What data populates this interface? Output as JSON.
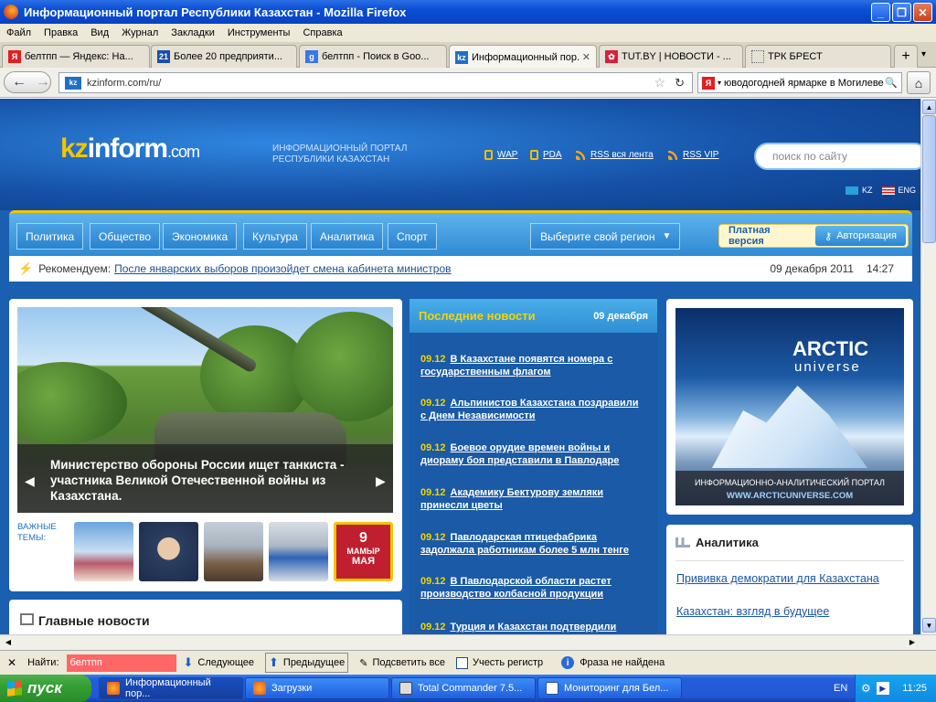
{
  "window": {
    "title": "Информационный портал Республики Казахстан - Mozilla Firefox"
  },
  "menu": [
    "Файл",
    "Правка",
    "Вид",
    "Журнал",
    "Закладки",
    "Инструменты",
    "Справка"
  ],
  "tabs": [
    {
      "label": "белтпп — Яндекс: На...",
      "icon": "yandex-icon",
      "color": "#e02020",
      "glyph": "Я"
    },
    {
      "label": "Более 20 предприяти...",
      "icon": "21-icon",
      "color": "#1a4fa8",
      "glyph": "21"
    },
    {
      "label": "белтпп - Поиск в Goo...",
      "icon": "google-icon",
      "color": "#3b78e7",
      "glyph": "g"
    },
    {
      "label": "Информационный пор...",
      "icon": "kz-icon",
      "color": "#1f6fc8",
      "glyph": "kz"
    },
    {
      "label": "TUT.BY | НОВОСТИ - ...",
      "icon": "tutby-icon",
      "color": "#d8203c",
      "glyph": "✿"
    },
    {
      "label": "ТРК БРЕСТ",
      "icon": "blank-page-icon",
      "color": "#ffffff",
      "glyph": ""
    }
  ],
  "nav": {
    "url": "kzinform.com/ru/",
    "search_value": "юводогодней ярмарке в Могилеве"
  },
  "site": {
    "logo_kz": "kz",
    "logo_inform": "inform",
    "logo_com": ".com",
    "portal_line1": "ИНФОРМАЦИОННЫЙ ПОРТАЛ",
    "portal_line2": "РЕСПУБЛИКИ КАЗАХСТАН",
    "links": [
      "WAP",
      "PDA",
      "RSS вся лента",
      "RSS VIP"
    ],
    "search_placeholder": "поиск по сайту",
    "lang_kz": "KZ",
    "lang_eng": "ENG"
  },
  "sections": [
    "Политика",
    "Общество",
    "Экономика",
    "Культура",
    "Аналитика",
    "Спорт"
  ],
  "region": "Выберите свой регион",
  "paid": "Платная версия",
  "auth": "Авторизация",
  "recommend": {
    "label": "Рекомендуем:",
    "link": "После январских выборов произойдет смена кабинета министров",
    "date": "09 декабря 2011",
    "time": "14:27"
  },
  "slider": {
    "caption": "Министерство обороны России ищет танкиста - участника Великой Отечественной войны из Казахстана."
  },
  "topics_label1": "ВАЖНЫЕ",
  "topics_label2": "ТЕМЫ:",
  "topic_badge": {
    "num": "9",
    "line1": "МАМЫР",
    "line2": "МАЯ"
  },
  "main_news": "Главные новости",
  "latest": {
    "title": "Последние новости",
    "date": "09 декабря",
    "items": [
      {
        "time": "09.12",
        "text": "В Казахстане появятся номера с государственным флагом"
      },
      {
        "time": "09.12",
        "text": "Альпинистов Казахстана поздравили с Днем Независимости"
      },
      {
        "time": "09.12",
        "text": "Боевое орудие времен войны и диораму боя представили в Павлодаре"
      },
      {
        "time": "09.12",
        "text": "Академику Бектурову земляки принесли цветы"
      },
      {
        "time": "09.12",
        "text": "Павлодарская птицефабрика задолжала работникам более 5 млн тенге"
      },
      {
        "time": "09.12",
        "text": "В Павлодарской области растет производство колбасной продукции"
      },
      {
        "time": "09.12",
        "text": "Турция и Казахстан подтвердили"
      }
    ]
  },
  "ad": {
    "line1": "ARCTIC",
    "line2": "universe",
    "strip1": "ИНФОРМАЦИОННО-АНАЛИТИЧЕСКИЙ ПОРТАЛ",
    "strip2": "WWW.ARCTICUNIVERSE.COM"
  },
  "analytics": {
    "title": "Аналитика",
    "links": [
      "Прививка демократии для Казахстана",
      "Казахстан: взгляд в будущее"
    ]
  },
  "find": {
    "label": "Найти:",
    "value": "белтпп",
    "next": "Следующее",
    "prev": "Предыдущее",
    "highlight": "Подсветить все",
    "matchcase": "Учесть регистр",
    "status": "Фраза не найдена"
  },
  "taskbar": {
    "start": "пуск",
    "tasks": [
      "Информационный пор...",
      "Загрузки",
      "Total Commander 7.5...",
      "Мониторинг для Бел..."
    ],
    "lang": "EN",
    "clock": "11:25"
  }
}
